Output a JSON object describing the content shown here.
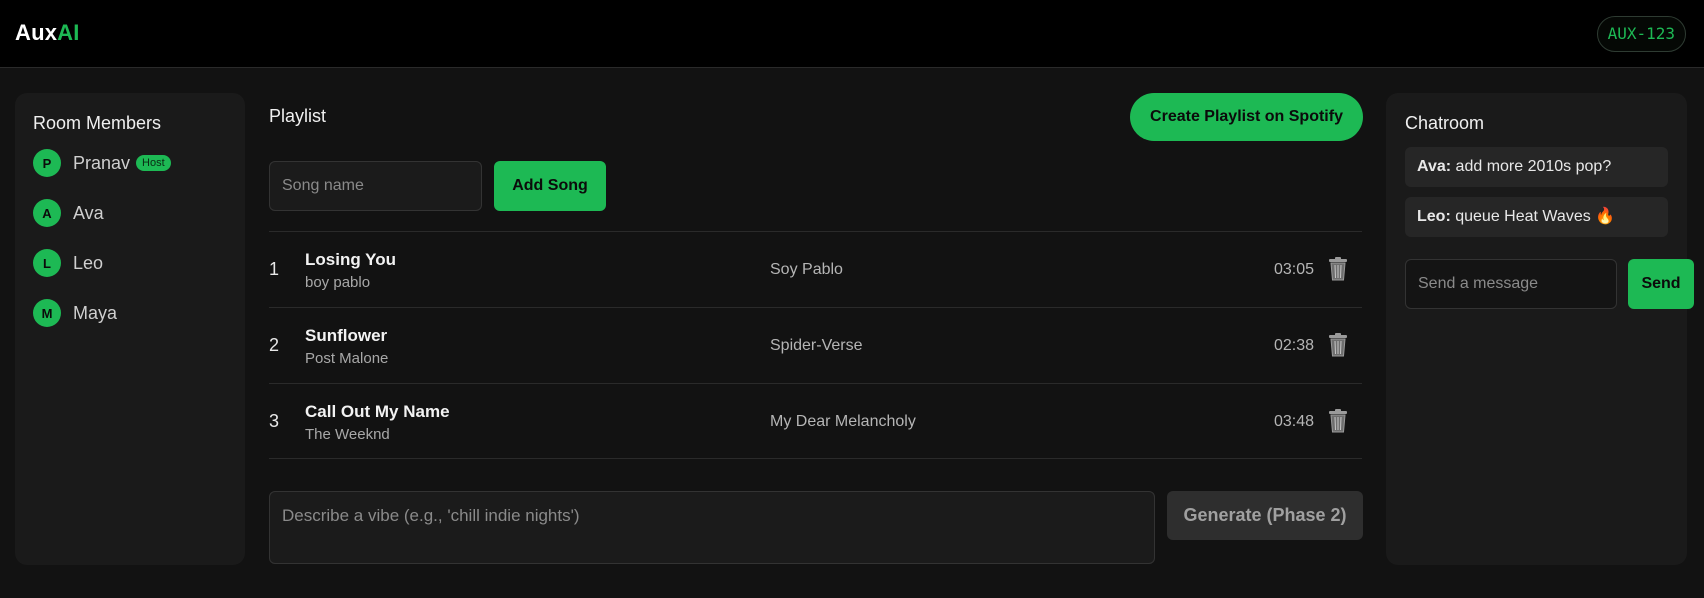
{
  "header": {
    "logo_main": "Aux",
    "logo_accent": "AI",
    "room_code": "AUX-123"
  },
  "members": {
    "title": "Room Members",
    "host_badge": "Host",
    "items": [
      {
        "initial": "P",
        "name": "Pranav",
        "is_host": true
      },
      {
        "initial": "A",
        "name": "Ava",
        "is_host": false
      },
      {
        "initial": "L",
        "name": "Leo",
        "is_host": false
      },
      {
        "initial": "M",
        "name": "Maya",
        "is_host": false
      }
    ]
  },
  "playlist": {
    "title": "Playlist",
    "create_label": "Create Playlist on Spotify",
    "song_placeholder": "Song name",
    "add_label": "Add Song",
    "tracks": [
      {
        "num": "1",
        "title": "Losing You",
        "artist": "boy pablo",
        "album": "Soy Pablo",
        "duration": "03:05"
      },
      {
        "num": "2",
        "title": "Sunflower",
        "artist": "Post Malone",
        "album": "Spider-Verse",
        "duration": "02:38"
      },
      {
        "num": "3",
        "title": "Call Out My Name",
        "artist": "The Weeknd",
        "album": "My Dear Melancholy",
        "duration": "03:48"
      }
    ],
    "vibe_placeholder": "Describe a vibe (e.g., 'chill indie nights')",
    "generate_label": "Generate (Phase 2)"
  },
  "chat": {
    "title": "Chatroom",
    "messages": [
      {
        "author": "Ava:",
        "text": "add more 2010s pop?"
      },
      {
        "author": "Leo:",
        "text": "queue Heat Waves 🔥"
      }
    ],
    "input_placeholder": "Send a message",
    "send_label": "Send"
  },
  "colors": {
    "accent": "#1db954",
    "background": "#121212",
    "panel": "#1a1a1a",
    "topbar": "#000000"
  },
  "icons": {
    "delete": "trash-icon"
  }
}
